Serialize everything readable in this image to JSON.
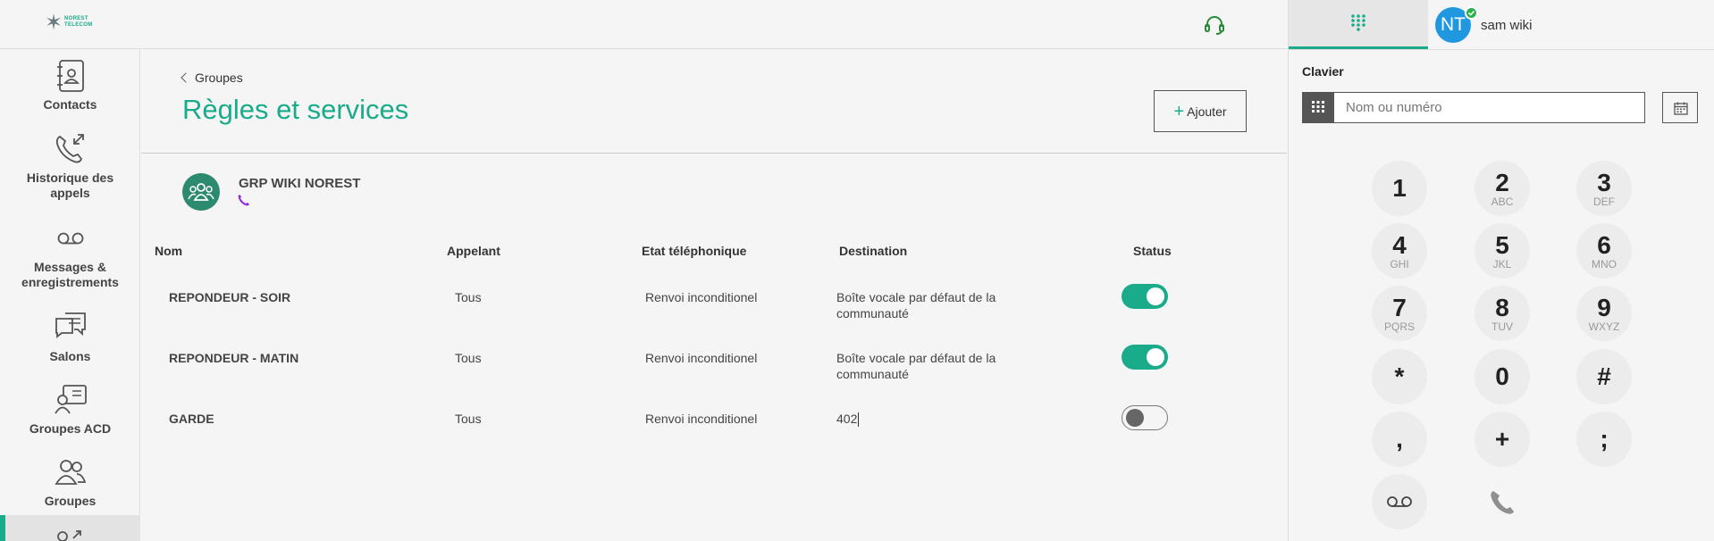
{
  "header": {
    "logo_line1": "NOREST",
    "logo_line2": "TELECOM"
  },
  "sidebar": {
    "items": [
      {
        "label": "Contacts"
      },
      {
        "label": "Historique des appels"
      },
      {
        "label": "Messages & enregistrements"
      },
      {
        "label": "Salons"
      },
      {
        "label": "Groupes ACD"
      },
      {
        "label": "Groupes"
      }
    ]
  },
  "main": {
    "breadcrumb": "Groupes",
    "title": "Règles et services",
    "add_label": "Ajouter",
    "group_name": "GRP WIKI NOREST",
    "columns": [
      "Nom",
      "Appelant",
      "Etat téléphonique",
      "Destination",
      "Status"
    ],
    "rows": [
      {
        "name": "REPONDEUR - SOIR",
        "caller": "Tous",
        "state": "Renvoi inconditionel",
        "destination_line1": "Boîte vocale par défaut de la",
        "destination_line2": "communauté",
        "enabled": true
      },
      {
        "name": "REPONDEUR - MATIN",
        "caller": "Tous",
        "state": "Renvoi inconditionel",
        "destination_line1": "Boîte vocale par défaut de la",
        "destination_line2": "communauté",
        "enabled": true
      },
      {
        "name": "GARDE",
        "caller": "Tous",
        "state": "Renvoi inconditionel",
        "destination_line1": "402",
        "destination_line2": "",
        "enabled": false
      }
    ]
  },
  "user": {
    "initials": "NT",
    "name": "sam wiki",
    "status_color": "#2bb24c"
  },
  "dialer": {
    "title": "Clavier",
    "input_placeholder": "Nom ou numéro",
    "keys": [
      {
        "digit": "1",
        "letters": ""
      },
      {
        "digit": "2",
        "letters": "ABC"
      },
      {
        "digit": "3",
        "letters": "DEF"
      },
      {
        "digit": "4",
        "letters": "GHI"
      },
      {
        "digit": "5",
        "letters": "JKL"
      },
      {
        "digit": "6",
        "letters": "MNO"
      },
      {
        "digit": "7",
        "letters": "PQRS"
      },
      {
        "digit": "8",
        "letters": "TUV"
      },
      {
        "digit": "9",
        "letters": "WXYZ"
      },
      {
        "digit": "*",
        "letters": ""
      },
      {
        "digit": "0",
        "letters": ""
      },
      {
        "digit": "#",
        "letters": ""
      },
      {
        "digit": ",",
        "letters": ""
      },
      {
        "digit": "+",
        "letters": ""
      },
      {
        "digit": ";",
        "letters": ""
      }
    ]
  },
  "colors": {
    "accent": "#1aab8a",
    "avatar_blue": "#1f98e0",
    "group_green": "#2c8a6e",
    "phone_purple": "#8a2be2"
  }
}
